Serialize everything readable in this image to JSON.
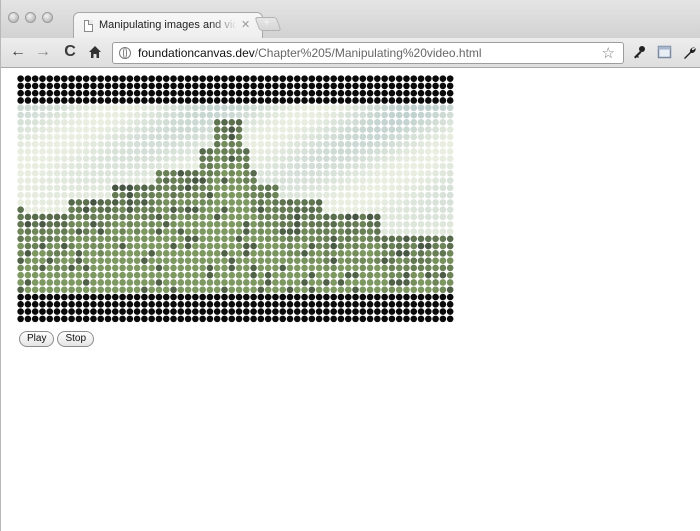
{
  "browser": {
    "tab": {
      "title": "Manipulating images and video",
      "close_icon": "close-icon"
    },
    "new_tab": "+",
    "toolbar": {
      "back_icon": "back-arrow-icon",
      "forward_icon": "forward-arrow-icon",
      "reload_icon": "reload-icon",
      "home_icon": "home-icon",
      "site_icon": "globe-icon",
      "url_host": "foundationcanvas.dev",
      "url_path": "/Chapter%205/Manipulating%20video.html",
      "bookmark_icon": "star-icon",
      "page_icon": "page-menu-icon",
      "wrench_icon": "wrench-icon"
    }
  },
  "page": {
    "video_canvas": {
      "description_icon": "pixelated-video-frame",
      "colors": {
        "letterbox": "#0a0a0a",
        "sky_light": "#e9eee0",
        "sky_blue": "#a9c0c4",
        "hill_green": "#7d9860",
        "rock_dark": "#3d4a3e"
      }
    },
    "controls": {
      "play_label": "Play",
      "stop_label": "Stop"
    }
  }
}
